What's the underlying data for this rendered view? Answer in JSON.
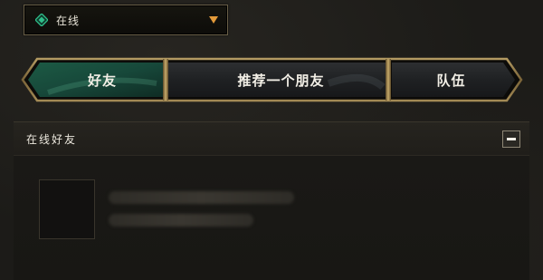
{
  "status": {
    "label": "在线",
    "icon": "online-status-icon",
    "accent_color": "#2fbf8a",
    "arrow_color": "#e39a3a"
  },
  "tabs": [
    {
      "label": "好友",
      "active": true
    },
    {
      "label": "推荐一个朋友",
      "active": false
    },
    {
      "label": "队伍",
      "active": false
    }
  ],
  "section": {
    "title": "在线好友",
    "collapse_icon": "minus-icon"
  },
  "colors": {
    "active_tab": "#1f5a46",
    "frame_gold": "#8a7446"
  }
}
